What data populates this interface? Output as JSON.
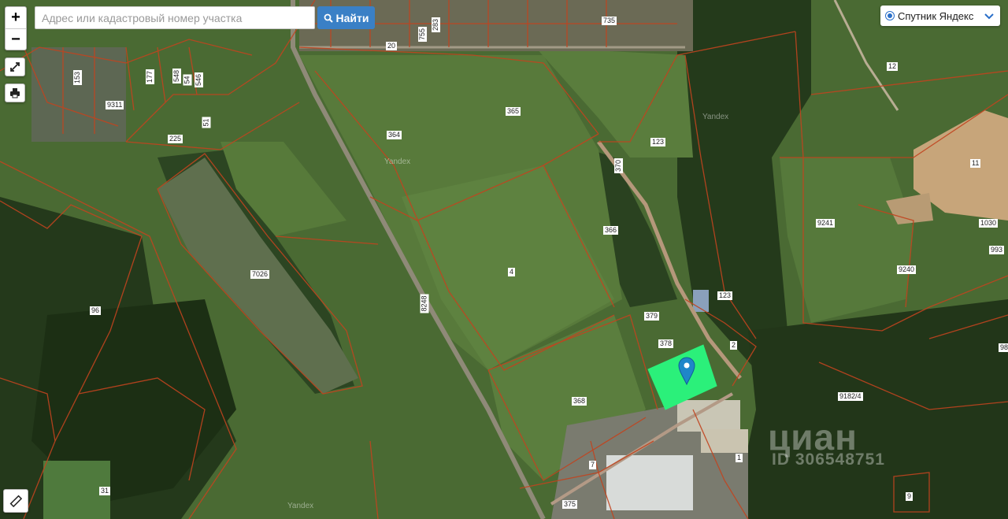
{
  "search": {
    "placeholder": "Адрес или кадастровый номер участка",
    "button_label": "Найти"
  },
  "controls": {
    "zoom_in": "+",
    "zoom_out": "−"
  },
  "layer_switch": {
    "label": "Спутник Яндекс"
  },
  "provider_labels": [
    "Yandex",
    "Yandex",
    "Yandex"
  ],
  "watermark": {
    "brand": "циан",
    "id_text": "ID 306548751"
  },
  "parcel_labels": [
    "20",
    "225",
    "283",
    "735",
    "755",
    "177",
    "9311",
    "364",
    "365",
    "366",
    "123",
    "123",
    "370",
    "379",
    "378",
    "368",
    "375",
    "7",
    "4",
    "7026",
    "96",
    "8248",
    "11",
    "12",
    "9241",
    "9240",
    "993",
    "1030",
    "9182/4",
    "2",
    "1",
    "9",
    "31",
    "98",
    "51",
    "153",
    "54",
    "548",
    "546"
  ],
  "highlight_color": "#2bf07a"
}
